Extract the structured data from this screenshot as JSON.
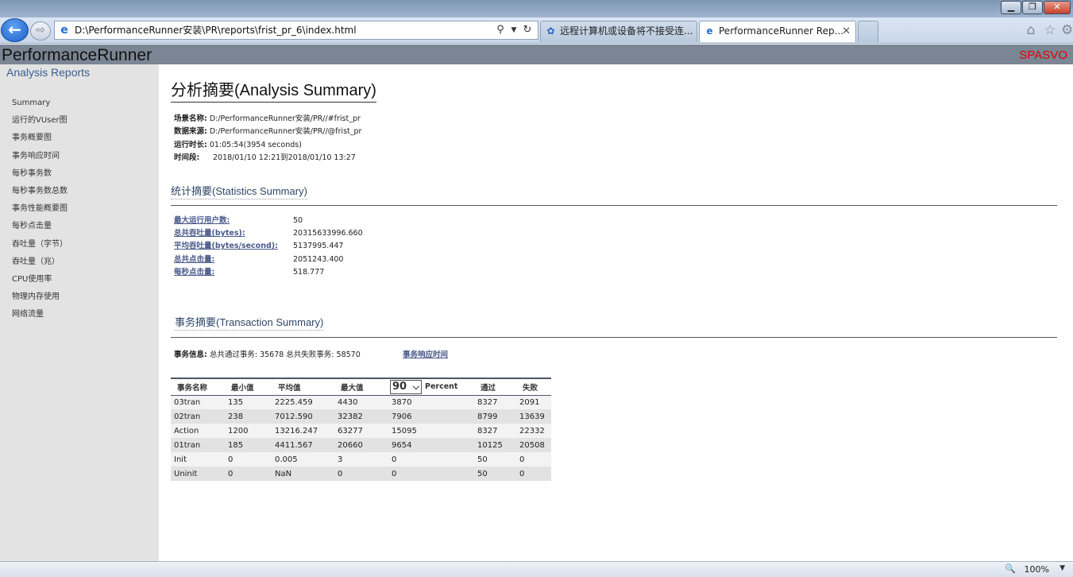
{
  "browser": {
    "address": "D:\\PerformanceRunner安装\\PR\\reports\\frist_pr_6\\index.html",
    "tabs": [
      {
        "label": "远程计算机或设备将不接受连..."
      },
      {
        "label": "PerformanceRunner Rep...",
        "close": "✕"
      }
    ],
    "window_buttons": {
      "min": "▁",
      "max": "❐",
      "close": "✕"
    },
    "zoom": "100%"
  },
  "header": {
    "app_title": "PerformanceRunner",
    "brand": "SPASVO"
  },
  "sidebar": {
    "subtitle": "Analysis Reports",
    "items": [
      "Summary",
      "运行的VUser图",
      "事务概要图",
      "事务响应时间",
      "每秒事务数",
      "每秒事务数总数",
      "事务性能概要图",
      "每秒点击量",
      "吞吐量（字节）",
      "吞吐量（兆）",
      "CPU使用率",
      "物理内存使用",
      "网络流量"
    ]
  },
  "summary": {
    "title": "分析摘要(Analysis Summary)",
    "info": [
      {
        "label": "场景名称:",
        "value": "D:/PerformanceRunner安装/PR//#frist_pr"
      },
      {
        "label": "数据来源:",
        "value": "D:/PerformanceRunner安装/PR//@frist_pr"
      },
      {
        "label": "运行时长:",
        "value": "01:05:54(3954 seconds)"
      },
      {
        "label": "时间段:",
        "value": "2018/01/10 12:21到2018/01/10 13:27"
      }
    ]
  },
  "stats": {
    "title": "统计摘要(Statistics Summary)",
    "rows": [
      {
        "label": "最大运行用户数:",
        "value": "50"
      },
      {
        "label": "总共吞吐量(bytes):",
        "value": "20315633996.660"
      },
      {
        "label": "平均吞吐量(bytes/second):",
        "value": "5137995.447"
      },
      {
        "label": "总共点击量:",
        "value": "2051243.400"
      },
      {
        "label": "每秒点击量:",
        "value": "518.777"
      }
    ]
  },
  "transactions": {
    "title": "事务摘要(Transaction Summary)",
    "info_label": "事务信息:",
    "info_value": "总共通过事务: 35678 总共失败事务: 58570",
    "link": "事务响应时间",
    "percent_selected": "90",
    "percent_label": "Percent",
    "columns": [
      "事务名称",
      "最小值",
      "平均值",
      "最大值",
      "",
      "通过",
      "失败"
    ],
    "rows": [
      [
        "03tran",
        "135",
        "2225.459",
        "4430",
        "3870",
        "8327",
        "2091"
      ],
      [
        "02tran",
        "238",
        "7012.590",
        "32382",
        "7906",
        "8799",
        "13639"
      ],
      [
        "Action",
        "1200",
        "13216.247",
        "63277",
        "15095",
        "8327",
        "22332"
      ],
      [
        "01tran",
        "185",
        "4411.567",
        "20660",
        "9654",
        "10125",
        "20508"
      ],
      [
        "Init",
        "0",
        "0.005",
        "3",
        "0",
        "50",
        "0"
      ],
      [
        "Uninit",
        "0",
        "NaN",
        "0",
        "0",
        "50",
        "0"
      ]
    ]
  }
}
